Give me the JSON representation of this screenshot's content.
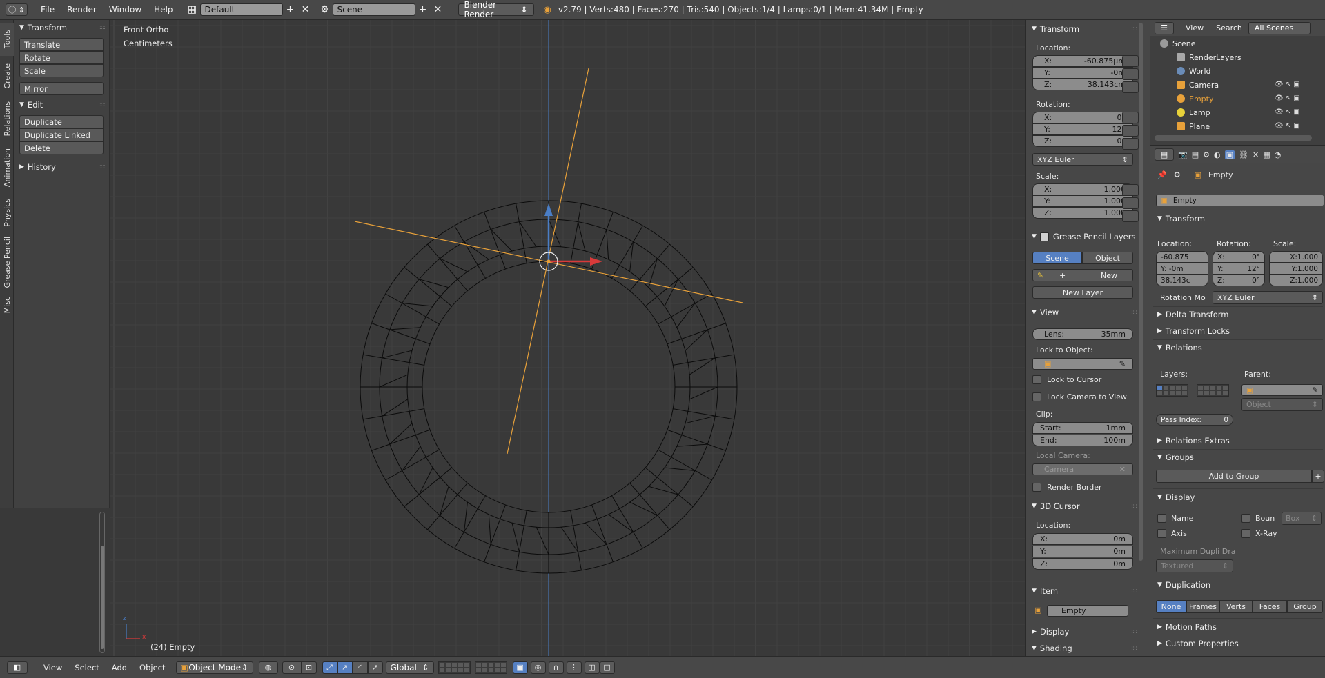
{
  "topbar": {
    "editor_icon": "info-icon",
    "menus": [
      "File",
      "Render",
      "Window",
      "Help"
    ],
    "screen_layout": "Default",
    "scene": "Scene",
    "render_engine": "Blender Render",
    "stats": "v2.79 | Verts:480 | Faces:270 | Tris:540 | Objects:1/4 | Lamps:0/1 | Mem:41.34M | Empty"
  },
  "left_tabs": [
    "Tools",
    "Create",
    "Relations",
    "Animation",
    "Physics",
    "Grease Pencil",
    "Misc"
  ],
  "toolshelf": {
    "transform_header": "Transform",
    "transform_buttons": [
      "Translate",
      "Rotate",
      "Scale"
    ],
    "mirror": "Mirror",
    "edit_header": "Edit",
    "edit_buttons": [
      "Duplicate",
      "Duplicate Linked",
      "Delete"
    ],
    "history_header": "History"
  },
  "viewport": {
    "view_name": "Front Ortho",
    "units": "Centimeters",
    "object_info": "(24) Empty",
    "axis_x": "x",
    "axis_z": "z"
  },
  "npanel": {
    "transform": {
      "header": "Transform",
      "location_label": "Location:",
      "location": [
        {
          "axis": "X:",
          "value": "-60.875µm"
        },
        {
          "axis": "Y:",
          "value": "-0m"
        },
        {
          "axis": "Z:",
          "value": "38.143cm"
        }
      ],
      "rotation_label": "Rotation:",
      "rotation": [
        {
          "axis": "X:",
          "value": "0°"
        },
        {
          "axis": "Y:",
          "value": "12°"
        },
        {
          "axis": "Z:",
          "value": "0°"
        }
      ],
      "rotation_mode": "XYZ Euler",
      "scale_label": "Scale:",
      "scale": [
        {
          "axis": "X:",
          "value": "1.000"
        },
        {
          "axis": "Y:",
          "value": "1.000"
        },
        {
          "axis": "Z:",
          "value": "1.000"
        }
      ]
    },
    "grease_pencil": {
      "header": "Grease Pencil Layers",
      "scene_tab": "Scene",
      "object_tab": "Object",
      "new_btn": "New",
      "new_layer_btn": "New Layer"
    },
    "view": {
      "header": "View",
      "lens": {
        "label": "Lens:",
        "value": "35mm"
      },
      "lock_to_object_label": "Lock to Object:",
      "lock_to_cursor": "Lock to Cursor",
      "lock_camera_to_view": "Lock Camera to View",
      "clip_label": "Clip:",
      "clip_start": {
        "label": "Start:",
        "value": "1mm"
      },
      "clip_end": {
        "label": "End:",
        "value": "100m"
      },
      "local_camera_label": "Local Camera:",
      "local_camera_value": "Camera",
      "render_border": "Render Border"
    },
    "cursor": {
      "header": "3D Cursor",
      "location_label": "Location:",
      "location": [
        {
          "axis": "X:",
          "value": "0m"
        },
        {
          "axis": "Y:",
          "value": "0m"
        },
        {
          "axis": "Z:",
          "value": "0m"
        }
      ]
    },
    "item": {
      "header": "Item",
      "name": "Empty"
    },
    "display_header": "Display",
    "shading_header": "Shading"
  },
  "outliner": {
    "view_menu": "View",
    "search_menu": "Search",
    "filter": "All Scenes",
    "rows": [
      "Scene",
      "RenderLayers",
      "World",
      "Camera",
      "Empty",
      "Lamp",
      "Plane"
    ]
  },
  "properties": {
    "object_name_breadcrumb": "Empty",
    "object_name_field": "Empty",
    "transform": {
      "header": "Transform",
      "location_label": "Location:",
      "rotation_label": "Rotation:",
      "scale_label": "Scale:",
      "location": [
        "-60.875",
        "Y:   -0m",
        "38.143c"
      ],
      "rotation": [
        {
          "axis": "X:",
          "value": "0°"
        },
        {
          "axis": "Y:",
          "value": "12°"
        },
        {
          "axis": "Z:",
          "value": "0°"
        }
      ],
      "scale": [
        "X:1.000",
        "Y:1.000",
        "Z:1.000"
      ],
      "rotation_mode_label": "Rotation Mo",
      "rotation_mode": "XYZ Euler"
    },
    "delta_transform": "Delta Transform",
    "transform_locks": "Transform Locks",
    "relations": {
      "header": "Relations",
      "layers_label": "Layers:",
      "parent_label": "Parent:",
      "parent_type": "Object",
      "pass_index_label": "Pass Index:",
      "pass_index_value": "0"
    },
    "relations_extras": "Relations Extras",
    "groups": {
      "header": "Groups",
      "add_to_group": "Add to Group"
    },
    "display": {
      "header": "Display",
      "name": "Name",
      "bounds": "Boun",
      "bounds_type": "Box",
      "axis": "Axis",
      "xray": "X-Ray",
      "max_dupli_label": "Maximum Dupli Dra",
      "max_dupli_value": "Textured"
    },
    "duplication": {
      "header": "Duplication",
      "options": [
        "None",
        "Frames",
        "Verts",
        "Faces",
        "Group"
      ],
      "selected": "None"
    },
    "motion_paths": "Motion Paths",
    "custom_properties": "Custom Properties"
  },
  "bottombar": {
    "menus": [
      "View",
      "Select",
      "Add",
      "Object"
    ],
    "mode": "Object Mode",
    "orientation": "Global"
  },
  "colors": {
    "accent": "#5680c2",
    "empty_orange": "#e8a13a",
    "grid_line": "#444444",
    "axis_blue": "#4a7ec6"
  }
}
